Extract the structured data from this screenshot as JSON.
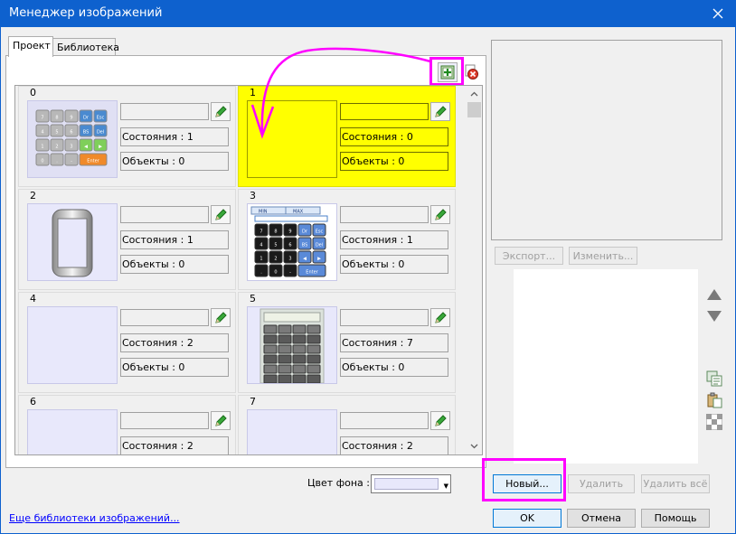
{
  "window": {
    "title": "Менеджер изображений"
  },
  "tabs": [
    {
      "label": "Проект"
    },
    {
      "label": "Библиотека"
    }
  ],
  "cells": [
    {
      "index": "0",
      "states": "Состояния : 1",
      "objects": "Объекты : 0"
    },
    {
      "index": "1",
      "states": "Состояния : 0",
      "objects": "Объекты : 0"
    },
    {
      "index": "2",
      "states": "Состояния : 1",
      "objects": "Объекты : 0"
    },
    {
      "index": "3",
      "states": "Состояния : 1",
      "objects": "Объекты : 0"
    },
    {
      "index": "4",
      "states": "Состояния : 2",
      "objects": "Объекты : 0"
    },
    {
      "index": "5",
      "states": "Состояния : 7",
      "objects": "Объекты : 0"
    },
    {
      "index": "6",
      "states": "Состояния : 2"
    },
    {
      "index": "7",
      "states": "Состояния : 2"
    }
  ],
  "thumb0_keys": [
    "7",
    "8",
    "9",
    "Dr",
    "Esc",
    "4",
    "5",
    "6",
    "BS",
    "Del",
    "1",
    "2",
    "3",
    "◀",
    "▶",
    "0",
    ".",
    "-",
    "Enter"
  ],
  "thumb3_keys": [
    "7",
    "8",
    "9",
    "Dr",
    "Esc",
    "4",
    "5",
    "6",
    "BS",
    "Del",
    "1",
    "2",
    "3",
    "◀",
    "▶",
    ".",
    "0",
    "-",
    "Enter"
  ],
  "thumb3_fields": [
    "MIN",
    "MAX"
  ],
  "right_panel": {
    "export_label": "Экспорт...",
    "change_label": "Изменить..."
  },
  "bottom": {
    "bg_color_label": "Цвет фона :",
    "new_label": "Новый...",
    "delete_label": "Удалить",
    "delete_all_label": "Удалить всё",
    "more_libraries_link": "Еще библиотеки изображений...",
    "ok_label": "OK",
    "cancel_label": "Отмена",
    "help_label": "Помощь"
  },
  "colors": {
    "titlebar": "#0e61ce",
    "selected_cell": "#ffff00",
    "annotation": "#ff00ff",
    "thumb_bg": "#e8e8fb"
  }
}
